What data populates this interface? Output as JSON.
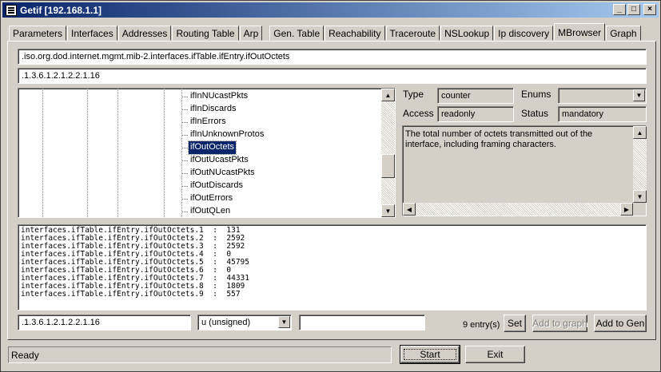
{
  "window": {
    "title": "Getif [192.168.1.1]"
  },
  "tabs": [
    {
      "label": "Parameters"
    },
    {
      "label": "Interfaces"
    },
    {
      "label": "Addresses"
    },
    {
      "label": "Routing Table"
    },
    {
      "label": "Arp"
    },
    {
      "label": "Gen. Table"
    },
    {
      "label": "Reachability"
    },
    {
      "label": "Traceroute"
    },
    {
      "label": "NSLookup"
    },
    {
      "label": "Ip discovery"
    },
    {
      "label": "MBrowser"
    },
    {
      "label": "Graph"
    }
  ],
  "active_tab": "MBrowser",
  "oid_name": ".iso.org.dod.internet.mgmt.mib-2.interfaces.ifTable.ifEntry.ifOutOctets",
  "oid_numeric": ".1.3.6.1.2.1.2.2.1.16",
  "tree": {
    "nodes": [
      {
        "label": "ifInNUcastPkts",
        "selected": false
      },
      {
        "label": "ifInDiscards",
        "selected": false
      },
      {
        "label": "ifInErrors",
        "selected": false
      },
      {
        "label": "ifInUnknownProtos",
        "selected": false
      },
      {
        "label": "ifOutOctets",
        "selected": true
      },
      {
        "label": "ifOutUcastPkts",
        "selected": false
      },
      {
        "label": "ifOutNUcastPkts",
        "selected": false
      },
      {
        "label": "ifOutDiscards",
        "selected": false
      },
      {
        "label": "ifOutErrors",
        "selected": false
      },
      {
        "label": "ifOutQLen",
        "selected": false
      }
    ]
  },
  "details": {
    "type_label": "Type",
    "type_value": "counter",
    "enums_label": "Enums",
    "enums_value": "",
    "access_label": "Access",
    "access_value": "readonly",
    "status_label": "Status",
    "status_value": "mandatory",
    "description": "The total number of octets transmitted out of the interface, including framing characters."
  },
  "output_rows": [
    "interfaces.ifTable.ifEntry.ifOutOctets.1  :  131",
    "interfaces.ifTable.ifEntry.ifOutOctets.2  :  2592",
    "interfaces.ifTable.ifEntry.ifOutOctets.3  :  2592",
    "interfaces.ifTable.ifEntry.ifOutOctets.4  :  0",
    "interfaces.ifTable.ifEntry.ifOutOctets.5  :  45795",
    "interfaces.ifTable.ifEntry.ifOutOctets.6  :  0",
    "interfaces.ifTable.ifEntry.ifOutOctets.7  :  44331",
    "interfaces.ifTable.ifEntry.ifOutOctets.8  :  1809",
    "interfaces.ifTable.ifEntry.ifOutOctets.9  :  557"
  ],
  "set_row": {
    "oid_value": ".1.3.6.1.2.1.2.2.1.16",
    "type_select": "u (unsigned)",
    "value_input": "",
    "entry_count": "9 entry(s)",
    "set_label": "Set",
    "add_graph_label": "Add to graph",
    "add_gen_label": "Add to Gen"
  },
  "status": {
    "text": "Ready"
  },
  "footer": {
    "start_label": "Start",
    "exit_label": "Exit"
  },
  "icons": {
    "app": "window-app-icon",
    "minimize": "minimize-icon",
    "maximize": "maximize-icon",
    "close": "close-icon"
  }
}
